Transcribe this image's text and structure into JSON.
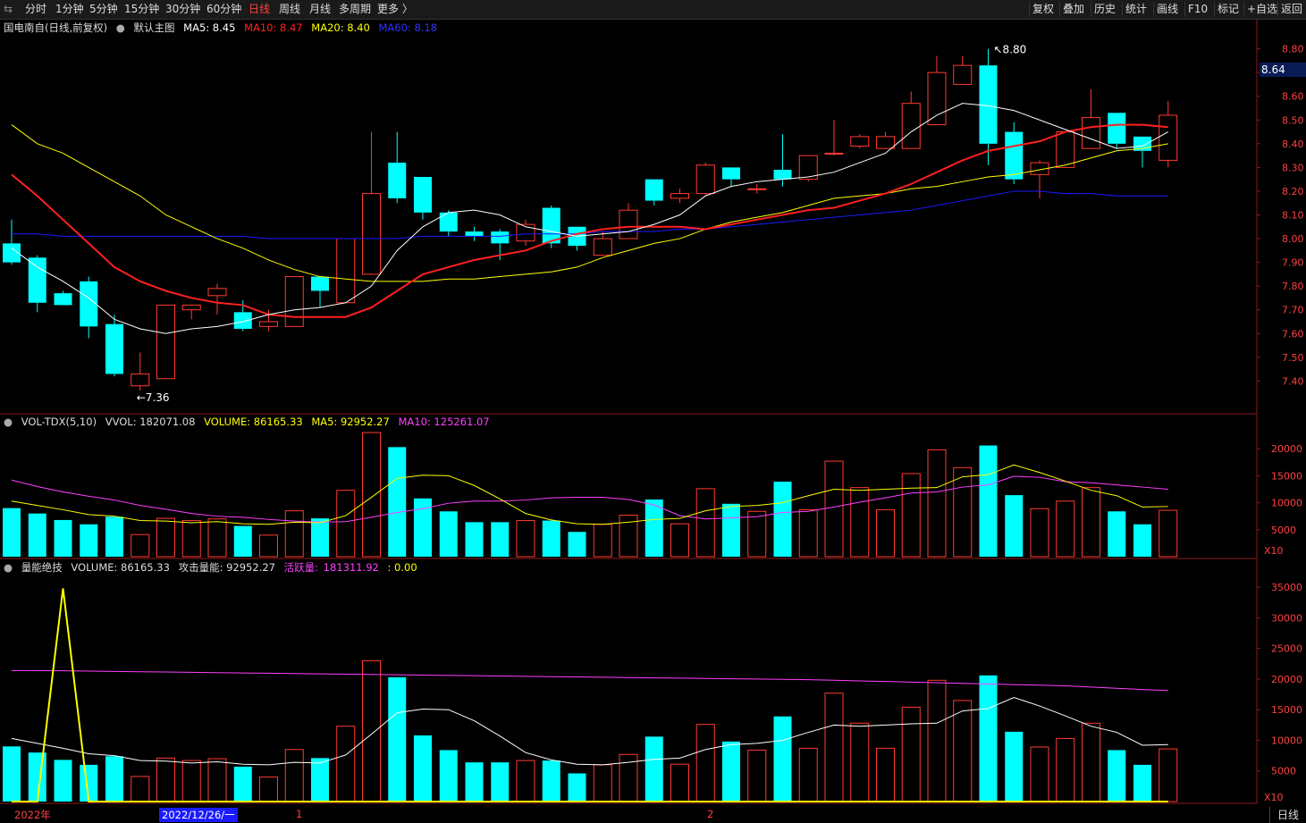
{
  "toolbar": {
    "left": [
      "分时",
      "1分钟",
      "5分钟",
      "15分钟",
      "30分钟",
      "60分钟",
      "日线",
      "周线",
      "月线",
      "多周期",
      "更多 〉"
    ],
    "active": "日线",
    "right": [
      "复权",
      "叠加",
      "历史",
      "统计",
      "画线",
      "F10",
      "标记",
      "+自选",
      "返回"
    ]
  },
  "main_header": {
    "stock": "国电南自(日线,前复权)",
    "indicator": "默认主图",
    "ma5": "MA5: 8.45",
    "ma10": "MA10: 8.47",
    "ma20": "MA20: 8.40",
    "ma60": "MA60: 8.18"
  },
  "vol_header": {
    "name": "VOL-TDX(5,10)",
    "vvol": "VVOL: 182071.08",
    "volume": "VOLUME: 86165.33",
    "ma5": "MA5: 92952.27",
    "ma10": "MA10: 125261.07"
  },
  "sub_header": {
    "name": "量能绝技",
    "volume": "VOLUME: 86165.33",
    "attack": "攻击量能: 92952.27",
    "active_label": "活跃量:",
    "active_value": "181311.92",
    "zero": ": 0.00"
  },
  "current_price": "8.64",
  "high_label": "8.80",
  "low_label": "7.36",
  "period_label": "日线",
  "timeline": {
    "year": "2022年",
    "cursor_date": "2022/12/26/一",
    "month1": "1",
    "month2": "2"
  },
  "x10_label": "X10",
  "colors": {
    "up": "#ff3b30",
    "down": "#00ffff",
    "ma5": "#ffffff",
    "ma10": "#ff2020",
    "ma20": "#ffff00",
    "ma60": "#1a1aff",
    "vol_ma5": "#ffff00",
    "vol_ma10": "#ff40ff",
    "grid": "#8b1a1a"
  },
  "chart_data": [
    {
      "type": "candlestick",
      "title": "国电南自(日线,前复权)",
      "ylim": [
        7.33,
        8.87
      ],
      "yticks": [
        7.4,
        7.5,
        7.6,
        7.7,
        7.8,
        7.9,
        8.0,
        8.1,
        8.2,
        8.3,
        8.4,
        8.5,
        8.6,
        8.7,
        8.8
      ],
      "candles": [
        [
          7.98,
          7.9,
          8.08,
          7.89
        ],
        [
          7.92,
          7.73,
          7.93,
          7.69
        ],
        [
          7.77,
          7.72,
          7.78,
          7.72
        ],
        [
          7.82,
          7.63,
          7.84,
          7.58
        ],
        [
          7.64,
          7.43,
          7.68,
          7.42
        ],
        [
          7.38,
          7.43,
          7.52,
          7.36
        ],
        [
          7.41,
          7.72,
          7.72,
          7.41
        ],
        [
          7.7,
          7.72,
          7.72,
          7.66
        ],
        [
          7.76,
          7.79,
          7.81,
          7.68
        ],
        [
          7.69,
          7.62,
          7.74,
          7.61
        ],
        [
          7.63,
          7.65,
          7.7,
          7.61
        ],
        [
          7.63,
          7.84,
          7.84,
          7.63
        ],
        [
          7.84,
          7.78,
          7.84,
          7.71
        ],
        [
          7.73,
          8.0,
          8.0,
          7.73
        ],
        [
          7.85,
          8.19,
          8.45,
          7.85
        ],
        [
          8.32,
          8.17,
          8.45,
          8.15
        ],
        [
          8.26,
          8.11,
          8.26,
          8.08
        ],
        [
          8.11,
          8.03,
          8.12,
          8.01
        ],
        [
          8.03,
          8.01,
          8.05,
          7.99
        ],
        [
          8.03,
          7.98,
          8.04,
          7.91
        ],
        [
          7.99,
          8.06,
          8.08,
          7.97
        ],
        [
          8.13,
          7.98,
          8.14,
          7.96
        ],
        [
          8.05,
          7.97,
          8.05,
          7.95
        ],
        [
          7.93,
          8.0,
          8.03,
          7.93
        ],
        [
          8.0,
          8.12,
          8.15,
          8.0
        ],
        [
          8.25,
          8.16,
          8.25,
          8.14
        ],
        [
          8.17,
          8.19,
          8.21,
          8.15
        ],
        [
          8.19,
          8.31,
          8.32,
          8.18
        ],
        [
          8.3,
          8.25,
          8.3,
          8.22
        ],
        [
          8.21,
          8.21,
          8.23,
          8.19
        ],
        [
          8.29,
          8.25,
          8.44,
          8.22
        ],
        [
          8.25,
          8.35,
          8.35,
          8.24
        ],
        [
          8.36,
          8.36,
          8.5,
          8.35
        ],
        [
          8.39,
          8.43,
          8.44,
          8.38
        ],
        [
          8.38,
          8.43,
          8.45,
          8.38
        ],
        [
          8.38,
          8.57,
          8.62,
          8.38
        ],
        [
          8.48,
          8.7,
          8.77,
          8.48
        ],
        [
          8.65,
          8.73,
          8.77,
          8.65
        ],
        [
          8.73,
          8.4,
          8.8,
          8.31
        ],
        [
          8.45,
          8.25,
          8.49,
          8.23
        ],
        [
          8.27,
          8.32,
          8.33,
          8.17
        ],
        [
          8.3,
          8.45,
          8.45,
          8.3
        ],
        [
          8.38,
          8.51,
          8.63,
          8.38
        ],
        [
          8.53,
          8.4,
          8.53,
          8.38
        ],
        [
          8.43,
          8.37,
          8.43,
          8.3
        ],
        [
          8.33,
          8.52,
          8.58,
          8.3
        ]
      ],
      "ma5": [
        7.96,
        7.88,
        7.82,
        7.75,
        7.66,
        7.62,
        7.6,
        7.62,
        7.63,
        7.65,
        7.68,
        7.7,
        7.71,
        7.73,
        7.8,
        7.95,
        8.05,
        8.11,
        8.12,
        8.1,
        8.05,
        8.03,
        8.01,
        8.02,
        8.03,
        8.06,
        8.1,
        8.18,
        8.22,
        8.24,
        8.25,
        8.26,
        8.28,
        8.32,
        8.36,
        8.45,
        8.52,
        8.57,
        8.56,
        8.54,
        8.5,
        8.46,
        8.42,
        8.38,
        8.39,
        8.45
      ],
      "ma10": [
        8.27,
        8.18,
        8.08,
        7.98,
        7.88,
        7.82,
        7.78,
        7.75,
        7.73,
        7.72,
        7.68,
        7.67,
        7.67,
        7.67,
        7.71,
        7.78,
        7.85,
        7.88,
        7.91,
        7.93,
        7.95,
        7.99,
        8.02,
        8.04,
        8.05,
        8.05,
        8.05,
        8.04,
        8.06,
        8.08,
        8.1,
        8.12,
        8.13,
        8.16,
        8.19,
        8.23,
        8.28,
        8.33,
        8.37,
        8.39,
        8.41,
        8.45,
        8.47,
        8.48,
        8.48,
        8.47
      ],
      "ma20": [
        8.48,
        8.4,
        8.36,
        8.3,
        8.24,
        8.18,
        8.1,
        8.05,
        8.0,
        7.96,
        7.91,
        7.87,
        7.84,
        7.83,
        7.82,
        7.82,
        7.82,
        7.83,
        7.83,
        7.84,
        7.85,
        7.86,
        7.88,
        7.92,
        7.95,
        7.98,
        8.0,
        8.04,
        8.07,
        8.09,
        8.11,
        8.14,
        8.17,
        8.18,
        8.19,
        8.21,
        8.22,
        8.24,
        8.26,
        8.27,
        8.29,
        8.31,
        8.34,
        8.37,
        8.38,
        8.4
      ],
      "ma60": [
        8.02,
        8.02,
        8.01,
        8.01,
        8.01,
        8.01,
        8.01,
        8.01,
        8.01,
        8.01,
        8.0,
        8.0,
        8.0,
        8.0,
        8.0,
        8.0,
        8.01,
        8.01,
        8.01,
        8.01,
        8.02,
        8.02,
        8.02,
        8.03,
        8.03,
        8.03,
        8.04,
        8.04,
        8.05,
        8.06,
        8.07,
        8.08,
        8.09,
        8.1,
        8.11,
        8.12,
        8.14,
        8.16,
        8.18,
        8.2,
        8.2,
        8.19,
        8.19,
        8.18,
        8.18,
        8.18
      ]
    },
    {
      "type": "bar",
      "title": "VOL-TDX(5,10)",
      "ylim": [
        0,
        24000
      ],
      "yticks": [
        5000,
        10000,
        15000,
        20000
      ],
      "volumes": [
        9000,
        8000,
        6800,
        6000,
        7400,
        4100,
        7100,
        6700,
        7000,
        5700,
        4000,
        8500,
        7100,
        12300,
        23000,
        20300,
        10800,
        8400,
        6400,
        6400,
        6700,
        6700,
        4600,
        6000,
        7700,
        10600,
        6100,
        12600,
        9800,
        8400,
        13900,
        8700,
        17700,
        12800,
        8700,
        15400,
        19800,
        16500,
        20600,
        11400,
        8900,
        10300,
        12800,
        8400,
        6000,
        8600
      ],
      "vol_ma5": [
        10300,
        9500,
        8700,
        7800,
        7500,
        6700,
        6600,
        6300,
        6500,
        6100,
        6000,
        6400,
        6300,
        7600,
        11000,
        14500,
        15100,
        15000,
        13200,
        10700,
        8000,
        6800,
        6100,
        6000,
        6400,
        6900,
        7100,
        8500,
        9300,
        9500,
        10000,
        11300,
        12500,
        12300,
        12500,
        12700,
        12800,
        14800,
        15200,
        17000,
        15600,
        14000,
        12300,
        11300,
        9200,
        9300
      ],
      "vol_ma10": [
        14200,
        13000,
        12000,
        11200,
        10500,
        9500,
        8800,
        8000,
        7500,
        7300,
        6900,
        6600,
        6400,
        6500,
        7300,
        8200,
        8900,
        9900,
        10300,
        10300,
        10500,
        10900,
        11000,
        11000,
        10600,
        9600,
        7600,
        7000,
        7200,
        7400,
        8200,
        8400,
        9200,
        10100,
        10900,
        11800,
        12000,
        12900,
        13300,
        14900,
        14700,
        13900,
        13700,
        13300,
        12900,
        12500
      ]
    },
    {
      "type": "bar",
      "title": "量能绝技",
      "ylim": [
        0,
        37500
      ],
      "yticks": [
        5000,
        10000,
        15000,
        20000,
        25000,
        30000,
        35000
      ],
      "attack": [
        10300,
        9500,
        8700,
        7800,
        7500,
        6700,
        6600,
        6300,
        6500,
        6100,
        6000,
        6400,
        6300,
        7600,
        11000,
        14500,
        15100,
        15000,
        13200,
        10700,
        8000,
        6800,
        6100,
        6000,
        6400,
        6900,
        7100,
        8500,
        9300,
        9500,
        10000,
        11300,
        12500,
        12300,
        12500,
        12700,
        12800,
        14800,
        15200,
        17000,
        15600,
        14000,
        12300,
        11300,
        9200,
        9300
      ],
      "active": [
        21400,
        21380,
        21350,
        21300,
        21250,
        21200,
        21150,
        21100,
        21050,
        21000,
        20950,
        20900,
        20850,
        20800,
        20750,
        20700,
        20650,
        20600,
        20550,
        20500,
        20450,
        20400,
        20350,
        20300,
        20250,
        20200,
        20150,
        20100,
        20050,
        20000,
        19950,
        19900,
        19800,
        19700,
        19600,
        19500,
        19400,
        19300,
        19200,
        19100,
        19000,
        18900,
        18700,
        18500,
        18300,
        18131
      ],
      "spike": [
        0,
        0,
        34800,
        0,
        0,
        0,
        0,
        0,
        0,
        0,
        0,
        0,
        0,
        0,
        0,
        0,
        0,
        0,
        0,
        0,
        0,
        0,
        0,
        0,
        0,
        0,
        0,
        0,
        0,
        0,
        0,
        0,
        0,
        0,
        0,
        0,
        0,
        0,
        0,
        0,
        0,
        0,
        0,
        0,
        0,
        0
      ]
    }
  ]
}
